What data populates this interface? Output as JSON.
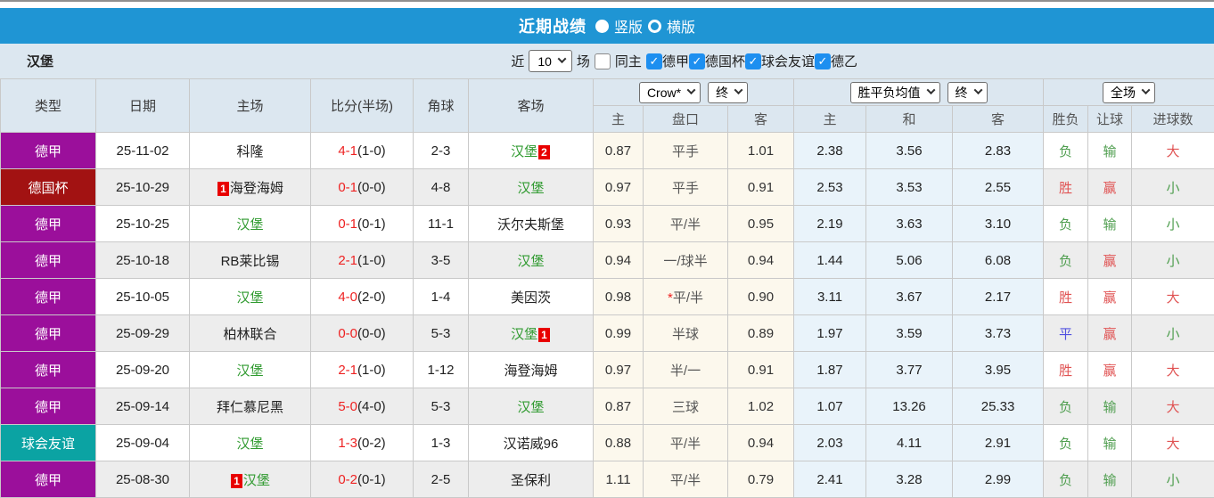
{
  "colors": {
    "title_bar_bg": "#1f95d4",
    "filter_bar_bg": "#dce7f0",
    "header_bg": "#dce7f0",
    "row_alt_bg": "#ededed",
    "odds_col_bg": "#fcf8ed",
    "avg_col_bg": "#e9f3fa",
    "score_red": "#ee2222",
    "team_green": "#2f9a2f",
    "rank_box_red": "#e80000",
    "result_red": "#e05353",
    "result_green": "#4f9e4f",
    "result_blue": "#5151e0",
    "league_colors": {
      "德甲": "#9b0f9b",
      "德国杯": "#a21212",
      "球会友谊": "#0ba3a3"
    }
  },
  "title_bar": {
    "title": "近期战绩",
    "radio_vertical": "竖版",
    "radio_horizontal": "横版",
    "selected": "竖版"
  },
  "filter_bar": {
    "team": "汉堡",
    "near_label": "近",
    "count_value": "10",
    "matches_label": "场",
    "same_home_label": "同主",
    "same_home_checked": false,
    "leagues": [
      "德甲",
      "德国杯",
      "球会友谊",
      "德乙"
    ],
    "leagues_checked": [
      true,
      true,
      true,
      true
    ]
  },
  "table": {
    "headers_left": [
      "类型",
      "日期",
      "主场",
      "比分(半场)",
      "角球",
      "客场"
    ],
    "group1": {
      "select_bookmaker": "Crow*",
      "select_time": "终"
    },
    "group2": {
      "select_name": "胜平负均值",
      "select_time": "终"
    },
    "group3": {
      "select_scope": "全场"
    },
    "sub_headers": [
      "主",
      "盘口",
      "客",
      "主",
      "和",
      "客",
      "胜负",
      "让球",
      "进球数"
    ],
    "rows": [
      {
        "league": "德甲",
        "date": "25-11-02",
        "home": "科隆",
        "home_green": false,
        "home_rank": "",
        "score": "4-1",
        "half": "(1-0)",
        "corners": "2-3",
        "away": "汉堡",
        "away_green": true,
        "away_rank": "2",
        "h_odds": "0.87",
        "line": "平手",
        "line_star": false,
        "a_odds": "1.01",
        "avg_h": "2.38",
        "avg_d": "3.56",
        "avg_a": "2.83",
        "result": "负",
        "result_color": "green",
        "handicap_result": "输",
        "handicap_result_color": "green",
        "goals": "大",
        "goals_color": "red"
      },
      {
        "league": "德国杯",
        "date": "25-10-29",
        "home": "海登海姆",
        "home_green": false,
        "home_rank": "1",
        "score": "0-1",
        "half": "(0-0)",
        "corners": "4-8",
        "away": "汉堡",
        "away_green": true,
        "away_rank": "",
        "h_odds": "0.97",
        "line": "平手",
        "line_star": false,
        "a_odds": "0.91",
        "avg_h": "2.53",
        "avg_d": "3.53",
        "avg_a": "2.55",
        "result": "胜",
        "result_color": "red",
        "handicap_result": "赢",
        "handicap_result_color": "red",
        "goals": "小",
        "goals_color": "green"
      },
      {
        "league": "德甲",
        "date": "25-10-25",
        "home": "汉堡",
        "home_green": true,
        "home_rank": "",
        "score": "0-1",
        "half": "(0-1)",
        "corners": "11-1",
        "away": "沃尔夫斯堡",
        "away_green": false,
        "away_rank": "",
        "h_odds": "0.93",
        "line": "平/半",
        "line_star": false,
        "a_odds": "0.95",
        "avg_h": "2.19",
        "avg_d": "3.63",
        "avg_a": "3.10",
        "result": "负",
        "result_color": "green",
        "handicap_result": "输",
        "handicap_result_color": "green",
        "goals": "小",
        "goals_color": "green"
      },
      {
        "league": "德甲",
        "date": "25-10-18",
        "home": "RB莱比锡",
        "home_green": false,
        "home_rank": "",
        "score": "2-1",
        "half": "(1-0)",
        "corners": "3-5",
        "away": "汉堡",
        "away_green": true,
        "away_rank": "",
        "h_odds": "0.94",
        "line": "一/球半",
        "line_star": false,
        "a_odds": "0.94",
        "avg_h": "1.44",
        "avg_d": "5.06",
        "avg_a": "6.08",
        "result": "负",
        "result_color": "green",
        "handicap_result": "赢",
        "handicap_result_color": "red",
        "goals": "小",
        "goals_color": "green"
      },
      {
        "league": "德甲",
        "date": "25-10-05",
        "home": "汉堡",
        "home_green": true,
        "home_rank": "",
        "score": "4-0",
        "half": "(2-0)",
        "corners": "1-4",
        "away": "美因茨",
        "away_green": false,
        "away_rank": "",
        "h_odds": "0.98",
        "line": "平/半",
        "line_star": true,
        "a_odds": "0.90",
        "avg_h": "3.11",
        "avg_d": "3.67",
        "avg_a": "2.17",
        "result": "胜",
        "result_color": "red",
        "handicap_result": "赢",
        "handicap_result_color": "red",
        "goals": "大",
        "goals_color": "red"
      },
      {
        "league": "德甲",
        "date": "25-09-29",
        "home": "柏林联合",
        "home_green": false,
        "home_rank": "",
        "score": "0-0",
        "half": "(0-0)",
        "corners": "5-3",
        "away": "汉堡",
        "away_green": true,
        "away_rank": "1",
        "h_odds": "0.99",
        "line": "半球",
        "line_star": false,
        "a_odds": "0.89",
        "avg_h": "1.97",
        "avg_d": "3.59",
        "avg_a": "3.73",
        "result": "平",
        "result_color": "blue",
        "handicap_result": "赢",
        "handicap_result_color": "red",
        "goals": "小",
        "goals_color": "green"
      },
      {
        "league": "德甲",
        "date": "25-09-20",
        "home": "汉堡",
        "home_green": true,
        "home_rank": "",
        "score": "2-1",
        "half": "(1-0)",
        "corners": "1-12",
        "away": "海登海姆",
        "away_green": false,
        "away_rank": "",
        "h_odds": "0.97",
        "line": "半/一",
        "line_star": false,
        "a_odds": "0.91",
        "avg_h": "1.87",
        "avg_d": "3.77",
        "avg_a": "3.95",
        "result": "胜",
        "result_color": "red",
        "handicap_result": "赢",
        "handicap_result_color": "red",
        "goals": "大",
        "goals_color": "red"
      },
      {
        "league": "德甲",
        "date": "25-09-14",
        "home": "拜仁慕尼黑",
        "home_green": false,
        "home_rank": "",
        "score": "5-0",
        "half": "(4-0)",
        "corners": "5-3",
        "away": "汉堡",
        "away_green": true,
        "away_rank": "",
        "h_odds": "0.87",
        "line": "三球",
        "line_star": false,
        "a_odds": "1.02",
        "avg_h": "1.07",
        "avg_d": "13.26",
        "avg_a": "25.33",
        "result": "负",
        "result_color": "green",
        "handicap_result": "输",
        "handicap_result_color": "green",
        "goals": "大",
        "goals_color": "red"
      },
      {
        "league": "球会友谊",
        "date": "25-09-04",
        "home": "汉堡",
        "home_green": true,
        "home_rank": "",
        "score": "1-3",
        "half": "(0-2)",
        "corners": "1-3",
        "away": "汉诺威96",
        "away_green": false,
        "away_rank": "",
        "h_odds": "0.88",
        "line": "平/半",
        "line_star": false,
        "a_odds": "0.94",
        "avg_h": "2.03",
        "avg_d": "4.11",
        "avg_a": "2.91",
        "result": "负",
        "result_color": "green",
        "handicap_result": "输",
        "handicap_result_color": "green",
        "goals": "大",
        "goals_color": "red"
      },
      {
        "league": "德甲",
        "date": "25-08-30",
        "home": "汉堡",
        "home_green": true,
        "home_rank": "1",
        "score": "0-2",
        "half": "(0-1)",
        "corners": "2-5",
        "away": "圣保利",
        "away_green": false,
        "away_rank": "",
        "h_odds": "1.11",
        "line": "平/半",
        "line_star": false,
        "a_odds": "0.79",
        "avg_h": "2.41",
        "avg_d": "3.28",
        "avg_a": "2.99",
        "result": "负",
        "result_color": "green",
        "handicap_result": "输",
        "handicap_result_color": "green",
        "goals": "小",
        "goals_color": "green"
      }
    ]
  }
}
